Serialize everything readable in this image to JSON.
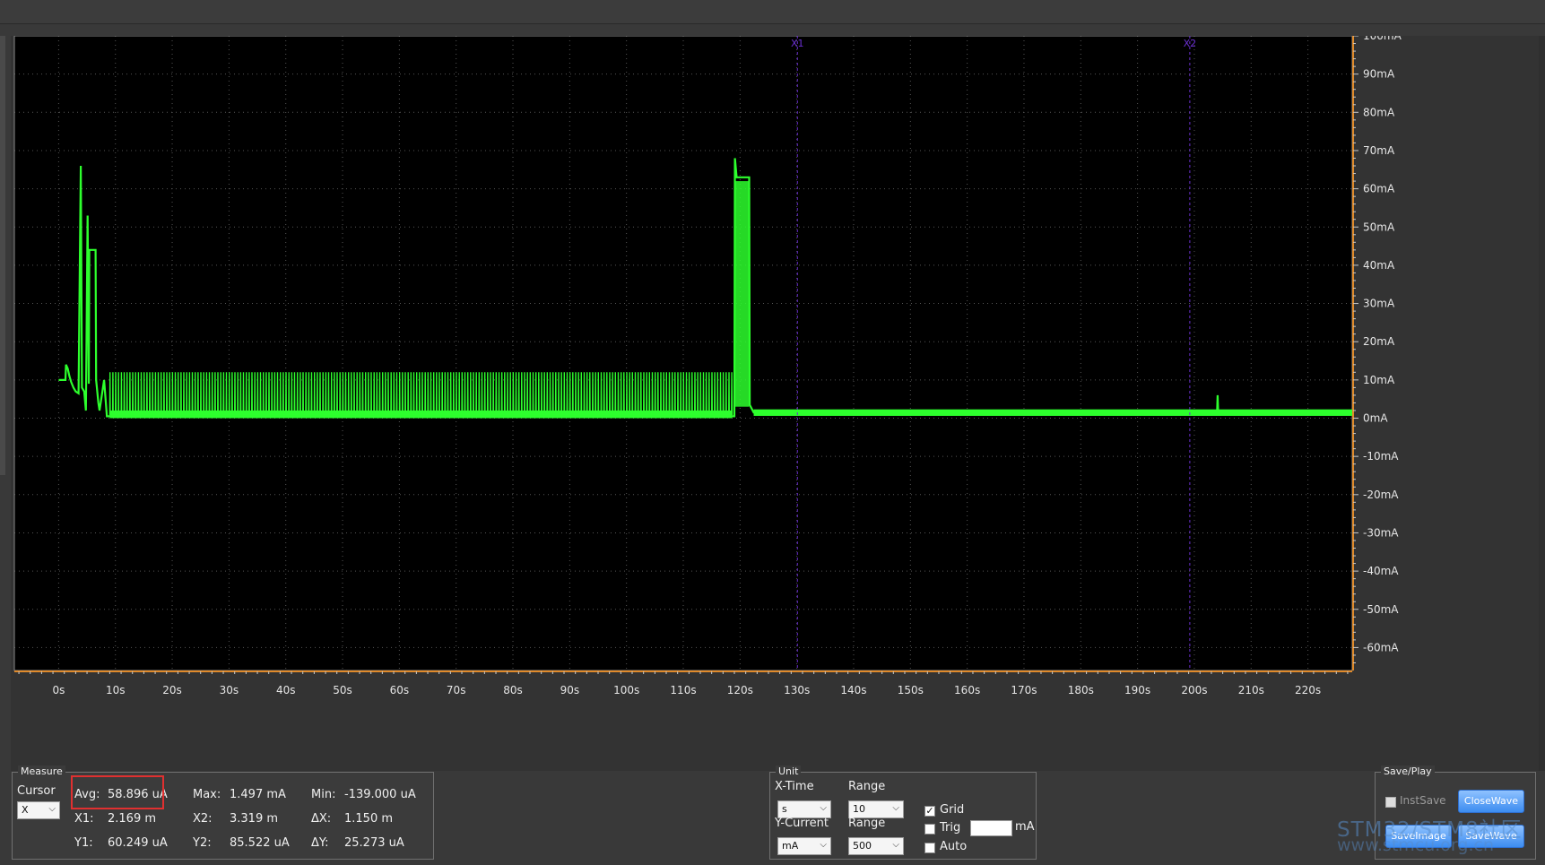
{
  "chart_data": {
    "type": "line",
    "x_unit": "s",
    "x_range": [
      -7.8,
      227.8
    ],
    "x_ticks": [
      "0s",
      "10s",
      "20s",
      "30s",
      "40s",
      "50s",
      "60s",
      "70s",
      "80s",
      "90s",
      "100s",
      "110s",
      "120s",
      "130s",
      "140s",
      "150s",
      "160s",
      "170s",
      "180s",
      "190s",
      "200s",
      "210s",
      "220s"
    ],
    "y_range": [
      -66,
      100
    ],
    "y_ticks": [
      {
        "v": 100,
        "label": "100mA"
      },
      {
        "v": 90,
        "label": "90mA"
      },
      {
        "v": 80,
        "label": "80mA"
      },
      {
        "v": 70,
        "label": "70mA"
      },
      {
        "v": 60,
        "label": "60mA"
      },
      {
        "v": 50,
        "label": "50mA"
      },
      {
        "v": 40,
        "label": "40mA"
      },
      {
        "v": 30,
        "label": "30mA"
      },
      {
        "v": 20,
        "label": "20mA"
      },
      {
        "v": 10,
        "label": "10mA"
      },
      {
        "v": 0,
        "label": "0mA"
      },
      {
        "v": -10,
        "label": "-10mA"
      },
      {
        "v": -20,
        "label": "-20mA"
      },
      {
        "v": -30,
        "label": "-30mA"
      },
      {
        "v": -40,
        "label": "-40mA"
      },
      {
        "v": -50,
        "label": "-50mA"
      },
      {
        "v": -60,
        "label": "-60mA"
      }
    ],
    "grid": true,
    "series_color": "#2dff2d",
    "cursor_color": "#6a2fd0",
    "cursors": [
      {
        "label": "X1",
        "x": 130.1
      },
      {
        "label": "X2",
        "x": 199.2
      }
    ],
    "trace": [
      [
        0.0,
        10.0
      ],
      [
        1.2,
        10.0
      ],
      [
        1.3,
        14.0
      ],
      [
        1.6,
        13.0
      ],
      [
        1.9,
        11.0
      ],
      [
        2.2,
        9.5
      ],
      [
        2.6,
        8.0
      ],
      [
        3.0,
        7.0
      ],
      [
        3.5,
        6.5
      ],
      [
        3.9,
        66.0
      ],
      [
        4.1,
        8.0
      ],
      [
        4.5,
        7.0
      ],
      [
        4.8,
        2.0
      ],
      [
        5.1,
        53.0
      ],
      [
        5.3,
        9.0
      ],
      [
        5.4,
        44.0
      ],
      [
        6.5,
        44.0
      ],
      [
        6.6,
        10.0
      ],
      [
        7.0,
        4.0
      ],
      [
        7.2,
        2.0
      ],
      [
        8.0,
        10.0
      ],
      [
        8.5,
        0.5
      ],
      [
        119.0,
        0.5
      ],
      [
        119.1,
        68.0
      ],
      [
        119.4,
        63.0
      ],
      [
        121.6,
        63.0
      ],
      [
        121.7,
        3.5
      ],
      [
        122.4,
        1.5
      ],
      [
        204.0,
        1.5
      ],
      [
        204.1,
        6.0
      ],
      [
        204.2,
        1.5
      ],
      [
        227.8,
        1.5
      ]
    ],
    "burst_region": {
      "x_start": 9.0,
      "x_end": 118.6,
      "period_s": 0.5,
      "base_mA": 0.8,
      "peak_mA": 12.0
    }
  },
  "measure": {
    "title": "Measure",
    "cursor_label": "Cursor",
    "cursor_value": "X",
    "avg_label": "Avg:",
    "avg_value": "58.896 uA",
    "max_label": "Max:",
    "max_value": "1.497 mA",
    "min_label": "Min:",
    "min_value": "-139.000 uA",
    "x1_label": "X1:",
    "x1_value": "2.169 m",
    "x2_label": "X2:",
    "x2_value": "3.319 m",
    "dx_label": "ΔX:",
    "dx_value": "1.150 m",
    "y1_label": "Y1:",
    "y1_value": "60.249 uA",
    "y2_label": "Y2:",
    "y2_value": "85.522 uA",
    "dy_label": "ΔY:",
    "dy_value": "25.273 uA"
  },
  "unit": {
    "title": "Unit",
    "xtime_label": "X-Time",
    "xtime_value": "s",
    "xrange_label": "Range",
    "xrange_value": "10",
    "ycur_label": "Y-Current",
    "ycur_value": "mA",
    "yrange_label": "Range",
    "yrange_value": "500",
    "grid_label": "Grid",
    "grid_checked": "✓",
    "trig_label": "Trig",
    "trig_unit": "mA",
    "auto_label": "Auto"
  },
  "saveplay": {
    "title": "Save/Play",
    "instsave_label": "InstSave",
    "closewave_label": "CloseWave",
    "saveimage_label": "SaveImage",
    "savewave_label": "SaveWave"
  },
  "watermark": {
    "line1": "STM32/STM8社区",
    "line2": "www.stmcu.org.cn"
  }
}
